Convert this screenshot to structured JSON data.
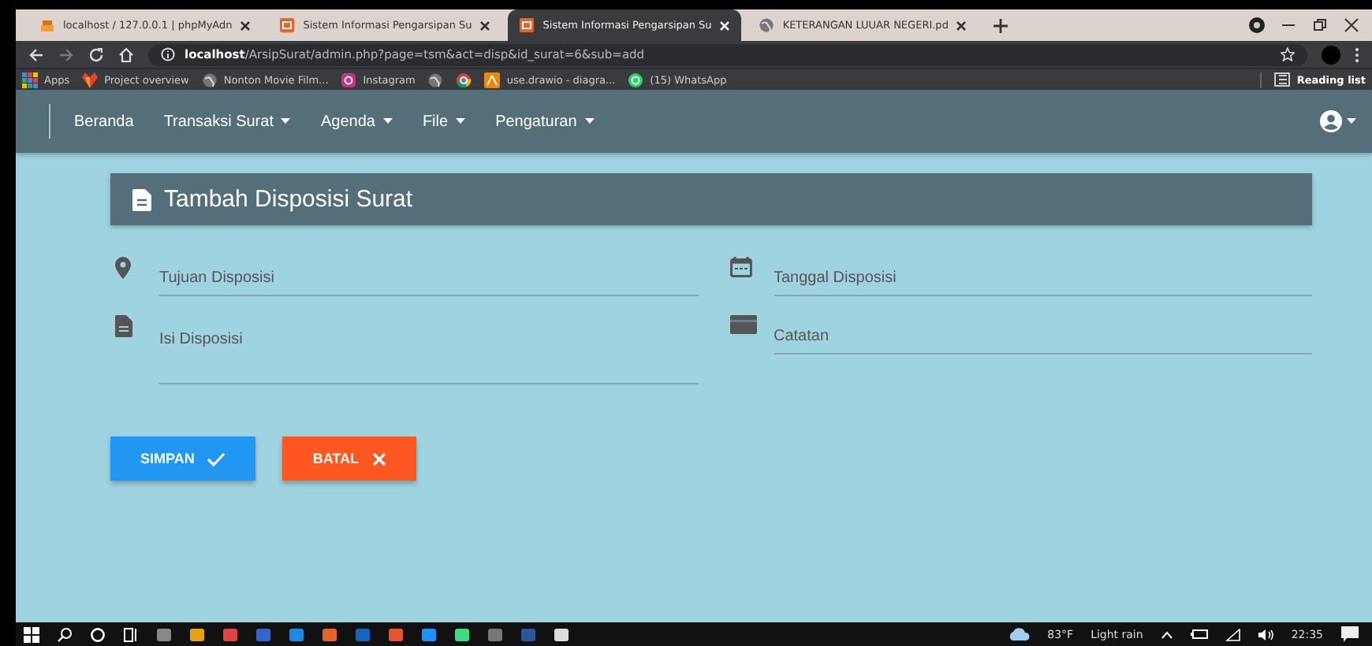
{
  "browser": {
    "tabs": [
      {
        "title": "localhost / 127.0.0.1 | phpMyAdn",
        "kind": "server",
        "selected": false
      },
      {
        "title": "Sistem Informasi Pengarsipan Su",
        "kind": "app",
        "selected": false
      },
      {
        "title": "Sistem Informasi Pengarsipan Su",
        "kind": "app",
        "selected": true
      },
      {
        "title": "KETERANGAN LUUAR NEGERI.pd",
        "kind": "globe",
        "selected": false
      }
    ],
    "address": {
      "host": "localhost",
      "path": "/ArsipSurat/admin.php?page=tsm&act=disp&id_surat=6&sub=add"
    },
    "bookmarks": [
      {
        "label": "Apps",
        "kind": "grid"
      },
      {
        "label": "Project overview",
        "kind": "fox"
      },
      {
        "label": "Nonton Movie Film...",
        "kind": "globe"
      },
      {
        "label": "Instagram",
        "kind": "camera"
      },
      {
        "kind": "globe"
      },
      {
        "kind": "chrome"
      },
      {
        "label": "use.drawio - diagra...",
        "kind": "drawio"
      },
      {
        "label": "(15) WhatsApp",
        "kind": "chat"
      }
    ],
    "reading_list": "Reading list"
  },
  "navbar": {
    "items": [
      {
        "label": "Beranda",
        "dropdown": false
      },
      {
        "label": "Transaksi Surat",
        "dropdown": true
      },
      {
        "label": "Agenda",
        "dropdown": true
      },
      {
        "label": "File",
        "dropdown": true
      },
      {
        "label": "Pengaturan",
        "dropdown": true
      }
    ]
  },
  "form": {
    "title": "Tambah Disposisi Surat",
    "fields": [
      {
        "placeholder": "Tujuan Disposisi",
        "kind": "pin"
      },
      {
        "placeholder": "Tanggal Disposisi",
        "kind": "calendar"
      },
      {
        "placeholder": "Isi Disposisi",
        "kind": "document"
      },
      {
        "placeholder": "Catatan",
        "kind": "card"
      }
    ],
    "buttons": [
      {
        "label": "SIMPAN",
        "kind": "save"
      },
      {
        "label": "BATAL",
        "kind": "cancel"
      }
    ]
  },
  "taskbar": {
    "temperature": "83°F",
    "weather": "Light rain",
    "time": "22:35"
  }
}
